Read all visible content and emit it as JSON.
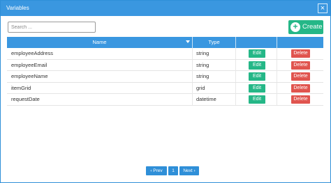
{
  "dialog": {
    "title": "Variables",
    "close_label": "×"
  },
  "search": {
    "placeholder": "Search ..."
  },
  "create": {
    "label": "Create",
    "icon": "plus-icon"
  },
  "table": {
    "headers": {
      "name": "Name",
      "type": "Type"
    },
    "rows": [
      {
        "name": "employeeAddress",
        "type": "string",
        "edit": "Edit",
        "delete": "Delete"
      },
      {
        "name": "employeeEmail",
        "type": "string",
        "edit": "Edit",
        "delete": "Delete"
      },
      {
        "name": "employeeName",
        "type": "string",
        "edit": "Edit",
        "delete": "Delete"
      },
      {
        "name": "itemGrid",
        "type": "grid",
        "edit": "Edit",
        "delete": "Delete"
      },
      {
        "name": "requestDate",
        "type": "datetime",
        "edit": "Edit",
        "delete": "Delete"
      }
    ]
  },
  "pagination": {
    "prev": "‹ Prev",
    "page": "1",
    "next": "Next ›"
  },
  "colors": {
    "accent": "#3a97e0",
    "edit": "#25b787",
    "delete": "#e0544e"
  }
}
